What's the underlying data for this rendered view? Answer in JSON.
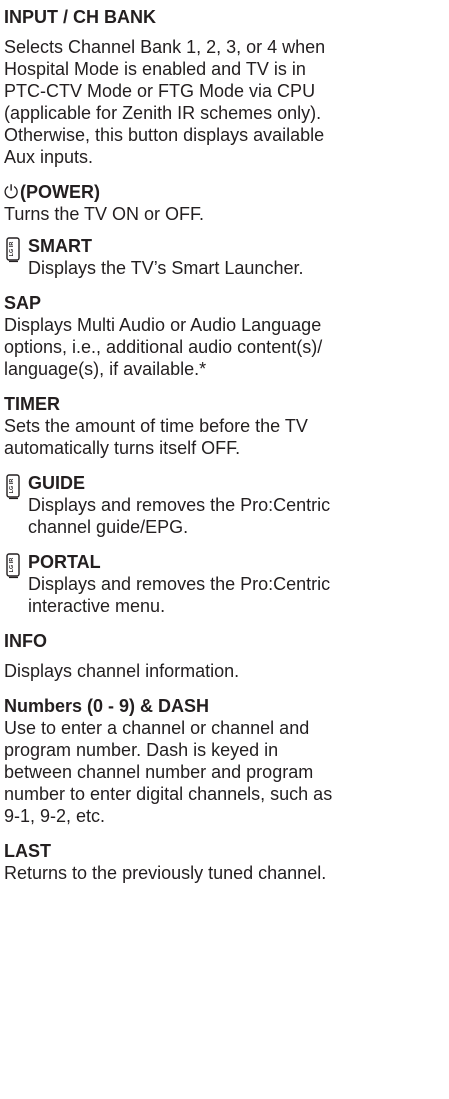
{
  "entries": [
    {
      "title": "INPUT / CH BANK",
      "lines": [
        "Selects Channel Bank 1, 2, 3, or 4 when",
        "Hospital Mode is enabled and TV is in",
        "PTC-CTV Mode or FTG Mode via CPU",
        "(applicable for Zenith IR schemes only).",
        "Otherwise, this button displays available",
        "Aux inputs."
      ]
    },
    {
      "title_icon": "⏻",
      "title": "(POWER)",
      "lines": [
        "Turns the TV ON or OFF."
      ]
    },
    {
      "icon": "LG IR",
      "title": "SMART",
      "lines": [
        "Displays the TV’s Smart Launcher."
      ]
    },
    {
      "title": "SAP",
      "lines": [
        "Displays Multi Audio or Audio Language",
        "options, i.e., additional audio content(s)/",
        "language(s), if available.*"
      ]
    },
    {
      "title": "TIMER",
      "lines": [
        "Sets the amount of time before the TV",
        "automatically turns itself OFF."
      ]
    },
    {
      "icon": "LG IR",
      "title": "GUIDE",
      "lines": [
        "Displays and removes the Pro:Centric",
        "channel guide/EPG."
      ]
    },
    {
      "icon": "LG IR",
      "title": "PORTAL",
      "lines": [
        "Displays and removes the Pro:Centric",
        "interactive menu."
      ]
    },
    {
      "title": "INFO",
      "lines": [
        "Displays channel information."
      ]
    },
    {
      "title": "Numbers (0 - 9) & DASH",
      "lines": [
        "Use to enter a channel or channel and",
        "program number. Dash is keyed in",
        "between channel number and program",
        "number to enter digital channels, such as",
        "9-1, 9-2, etc."
      ]
    },
    {
      "title": "LAST",
      "lines": [
        "Returns to the previously tuned channel."
      ]
    }
  ]
}
